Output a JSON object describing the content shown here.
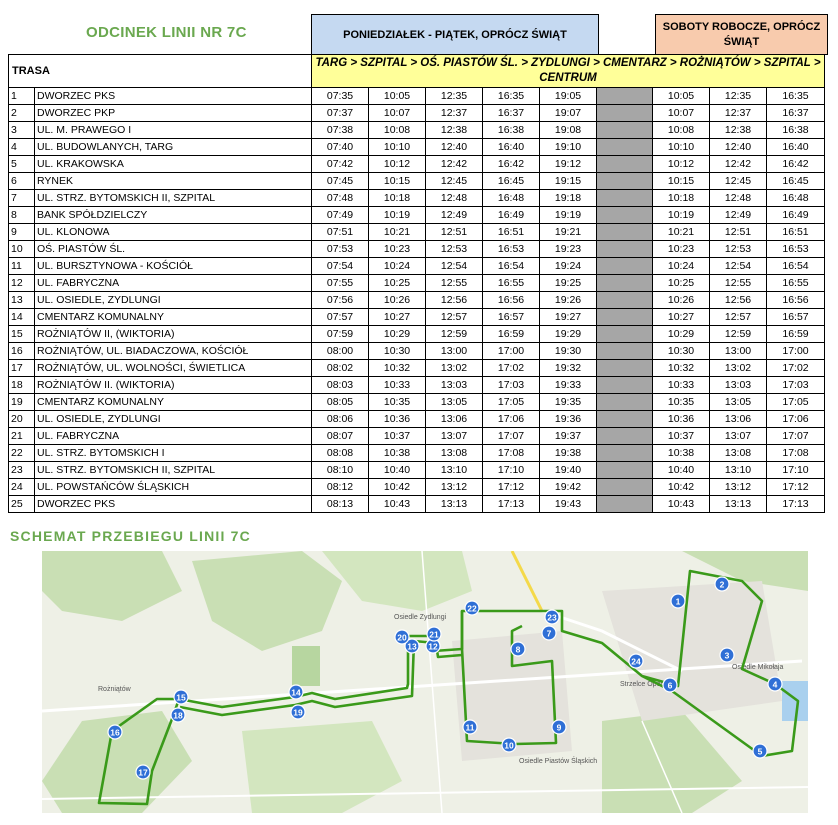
{
  "title": "ODCINEK LINII NR 7C",
  "weekday_header": "PONIEDZIAŁEK - PIĄTEK, OPRÓCZ ŚWIĄT",
  "saturday_header": "SOBOTY ROBOCZE, OPRÓCZ ŚWIĄT",
  "trasa_label": "TRASA",
  "route_description": "TARG > SZPITAL > OŚ. PIASTÓW ŚL. > ZYDLUNGI > CMENTARZ > ROŻNIĄTÓW > SZPITAL > CENTRUM",
  "stops": [
    {
      "no": "1",
      "name": "DWORZEC PKS",
      "weekday": [
        "07:35",
        "10:05",
        "12:35",
        "16:35",
        "19:05"
      ],
      "saturday": [
        "10:05",
        "12:35",
        "16:35"
      ]
    },
    {
      "no": "2",
      "name": "DWORZEC PKP",
      "weekday": [
        "07:37",
        "10:07",
        "12:37",
        "16:37",
        "19:07"
      ],
      "saturday": [
        "10:07",
        "12:37",
        "16:37"
      ]
    },
    {
      "no": "3",
      "name": "UL. M. PRAWEGO I",
      "weekday": [
        "07:38",
        "10:08",
        "12:38",
        "16:38",
        "19:08"
      ],
      "saturday": [
        "10:08",
        "12:38",
        "16:38"
      ]
    },
    {
      "no": "4",
      "name": "UL. BUDOWLANYCH, TARG",
      "weekday": [
        "07:40",
        "10:10",
        "12:40",
        "16:40",
        "19:10"
      ],
      "saturday": [
        "10:10",
        "12:40",
        "16:40"
      ]
    },
    {
      "no": "5",
      "name": "UL. KRAKOWSKA",
      "weekday": [
        "07:42",
        "10:12",
        "12:42",
        "16:42",
        "19:12"
      ],
      "saturday": [
        "10:12",
        "12:42",
        "16:42"
      ]
    },
    {
      "no": "6",
      "name": "RYNEK",
      "weekday": [
        "07:45",
        "10:15",
        "12:45",
        "16:45",
        "19:15"
      ],
      "saturday": [
        "10:15",
        "12:45",
        "16:45"
      ]
    },
    {
      "no": "7",
      "name": "UL. STRZ. BYTOMSKICH II, SZPITAL",
      "weekday": [
        "07:48",
        "10:18",
        "12:48",
        "16:48",
        "19:18"
      ],
      "saturday": [
        "10:18",
        "12:48",
        "16:48"
      ]
    },
    {
      "no": "8",
      "name": "BANK SPÓŁDZIELCZY",
      "weekday": [
        "07:49",
        "10:19",
        "12:49",
        "16:49",
        "19:19"
      ],
      "saturday": [
        "10:19",
        "12:49",
        "16:49"
      ]
    },
    {
      "no": "9",
      "name": "UL. KLONOWA",
      "weekday": [
        "07:51",
        "10:21",
        "12:51",
        "16:51",
        "19:21"
      ],
      "saturday": [
        "10:21",
        "12:51",
        "16:51"
      ]
    },
    {
      "no": "10",
      "name": "OŚ. PIASTÓW ŚL.",
      "weekday": [
        "07:53",
        "10:23",
        "12:53",
        "16:53",
        "19:23"
      ],
      "saturday": [
        "10:23",
        "12:53",
        "16:53"
      ]
    },
    {
      "no": "11",
      "name": "UL. BURSZTYNOWA - KOŚCIÓŁ",
      "weekday": [
        "07:54",
        "10:24",
        "12:54",
        "16:54",
        "19:24"
      ],
      "saturday": [
        "10:24",
        "12:54",
        "16:54"
      ]
    },
    {
      "no": "12",
      "name": "UL. FABRYCZNA",
      "weekday": [
        "07:55",
        "10:25",
        "12:55",
        "16:55",
        "19:25"
      ],
      "saturday": [
        "10:25",
        "12:55",
        "16:55"
      ]
    },
    {
      "no": "13",
      "name": "UL. OSIEDLE, ZYDLUNGI",
      "weekday": [
        "07:56",
        "10:26",
        "12:56",
        "16:56",
        "19:26"
      ],
      "saturday": [
        "10:26",
        "12:56",
        "16:56"
      ]
    },
    {
      "no": "14",
      "name": "CMENTARZ KOMUNALNY",
      "weekday": [
        "07:57",
        "10:27",
        "12:57",
        "16:57",
        "19:27"
      ],
      "saturday": [
        "10:27",
        "12:57",
        "16:57"
      ]
    },
    {
      "no": "15",
      "name": "ROŻNIĄTÓW II, (WIKTORIA)",
      "weekday": [
        "07:59",
        "10:29",
        "12:59",
        "16:59",
        "19:29"
      ],
      "saturday": [
        "10:29",
        "12:59",
        "16:59"
      ]
    },
    {
      "no": "16",
      "name": "ROŻNIĄTÓW, UL. BIADACZOWA, KOŚCIÓŁ",
      "weekday": [
        "08:00",
        "10:30",
        "13:00",
        "17:00",
        "19:30"
      ],
      "saturday": [
        "10:30",
        "13:00",
        "17:00"
      ]
    },
    {
      "no": "17",
      "name": "ROŻNIĄTÓW, UL. WOLNOŚCI, ŚWIETLICA",
      "weekday": [
        "08:02",
        "10:32",
        "13:02",
        "17:02",
        "19:32"
      ],
      "saturday": [
        "10:32",
        "13:02",
        "17:02"
      ]
    },
    {
      "no": "18",
      "name": "ROŻNIĄTÓW II. (WIKTORIA)",
      "weekday": [
        "08:03",
        "10:33",
        "13:03",
        "17:03",
        "19:33"
      ],
      "saturday": [
        "10:33",
        "13:03",
        "17:03"
      ]
    },
    {
      "no": "19",
      "name": "CMENTARZ KOMUNALNY",
      "weekday": [
        "08:05",
        "10:35",
        "13:05",
        "17:05",
        "19:35"
      ],
      "saturday": [
        "10:35",
        "13:05",
        "17:05"
      ]
    },
    {
      "no": "20",
      "name": "UL. OSIEDLE, ZYDLUNGI",
      "weekday": [
        "08:06",
        "10:36",
        "13:06",
        "17:06",
        "19:36"
      ],
      "saturday": [
        "10:36",
        "13:06",
        "17:06"
      ]
    },
    {
      "no": "21",
      "name": "UL. FABRYCZNA",
      "weekday": [
        "08:07",
        "10:37",
        "13:07",
        "17:07",
        "19:37"
      ],
      "saturday": [
        "10:37",
        "13:07",
        "17:07"
      ]
    },
    {
      "no": "22",
      "name": "UL. STRZ. BYTOMSKICH I",
      "weekday": [
        "08:08",
        "10:38",
        "13:08",
        "17:08",
        "19:38"
      ],
      "saturday": [
        "10:38",
        "13:08",
        "17:08"
      ]
    },
    {
      "no": "23",
      "name": "UL. STRZ. BYTOMSKICH II, SZPITAL",
      "weekday": [
        "08:10",
        "10:40",
        "13:10",
        "17:10",
        "19:40"
      ],
      "saturday": [
        "10:40",
        "13:10",
        "17:10"
      ]
    },
    {
      "no": "24",
      "name": "UL. POWSTAŃCÓW ŚLĄSKICH",
      "weekday": [
        "08:12",
        "10:42",
        "13:12",
        "17:12",
        "19:42"
      ],
      "saturday": [
        "10:42",
        "13:12",
        "17:12"
      ]
    },
    {
      "no": "25",
      "name": "DWORZEC PKS",
      "weekday": [
        "08:13",
        "10:43",
        "13:13",
        "17:13",
        "19:43"
      ],
      "saturday": [
        "10:43",
        "13:13",
        "17:13"
      ]
    }
  ],
  "schemat_title": "SCHEMAT PRZEBIEGU LINII 7C",
  "map": {
    "route_color": "#3a9a1a",
    "stop_color": "#2f6fd6",
    "place_labels": [
      "Rożniątów",
      "Osiedle Zydlungi",
      "Osiedle Piastów Śląskich",
      "Strzelce Opolskie",
      "Osiedle Mikołaja"
    ]
  }
}
